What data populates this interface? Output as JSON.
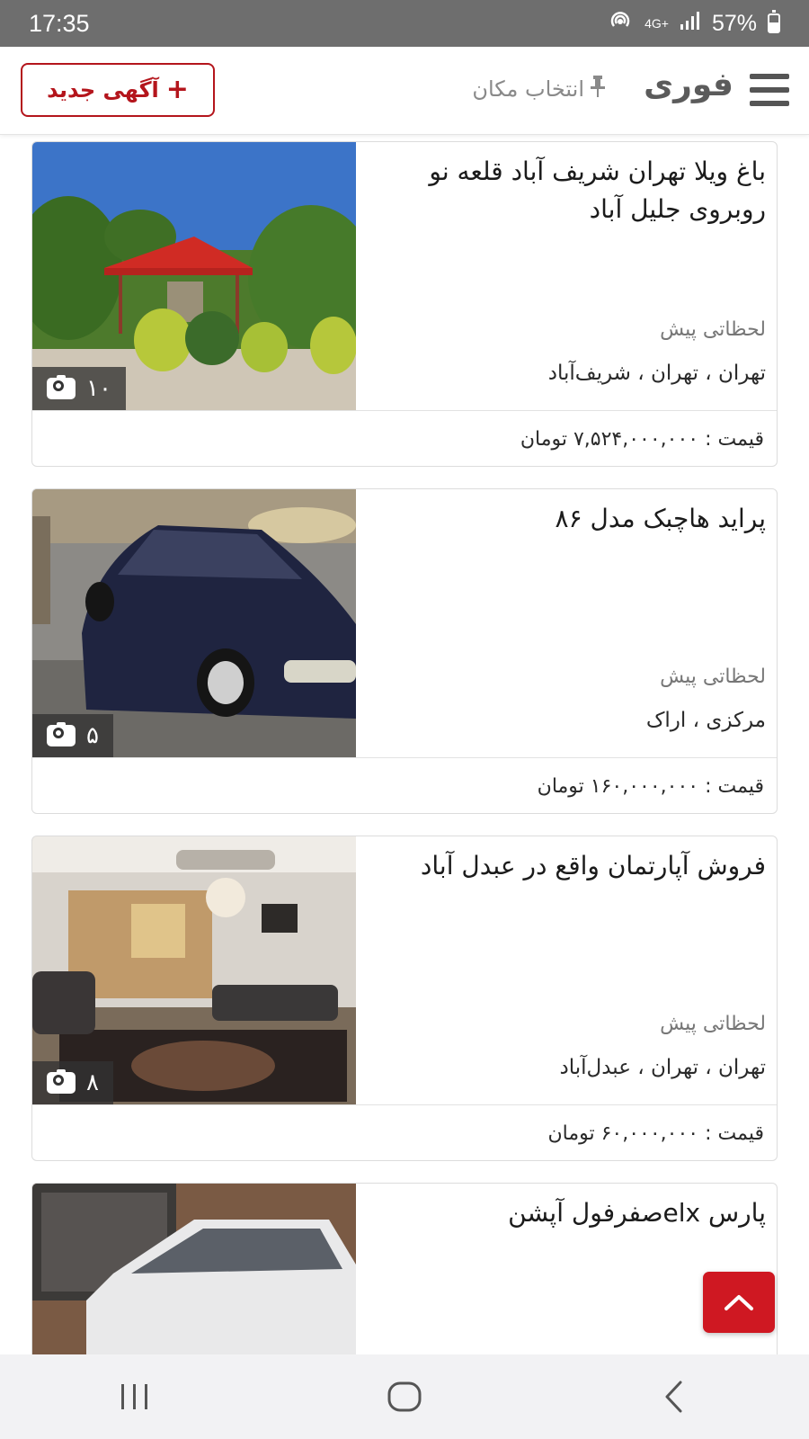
{
  "status_bar": {
    "time": "17:35",
    "network": "4G+",
    "battery": "57%",
    "hotspot_icon": "hotspot-icon",
    "signal_icon": "signal-icon"
  },
  "header": {
    "brand": "فوری",
    "location_picker": "انتخاب مکان",
    "new_ad_button": "آگهی جدید",
    "menu_icon": "hamburger-menu-icon",
    "pin_icon": "pin-icon"
  },
  "ads": [
    {
      "title": "باغ ویلا تهران شریف آباد قلعه نو روبروی جلیل آباد",
      "time": "لحظاتی پیش",
      "location": "تهران ، تهران ، شریف‌آباد",
      "price": "قیمت : ۷,۵۲۴,۰۰۰,۰۰۰ تومان",
      "photo_count": "۱۰",
      "photo_subject": "garden villa with red gazebo"
    },
    {
      "title": "پراید هاچبک مدل ۸۶",
      "time": "لحظاتی پیش",
      "location": "مرکزی ، اراک",
      "price": "قیمت : ۱۶۰,۰۰۰,۰۰۰ تومان",
      "photo_count": "۵",
      "photo_subject": "dark blue hatchback car"
    },
    {
      "title": "فروش آپارتمان واقع در عبدل آباد",
      "time": "لحظاتی پیش",
      "location": "تهران ، تهران ، عبدل‌آباد",
      "price": "قیمت : ۶۰,۰۰۰,۰۰۰ تومان",
      "photo_count": "۸",
      "photo_subject": "apartment living room"
    },
    {
      "title": "پارس elxصفرفول آپشن",
      "photo_subject": "white sedan car"
    }
  ],
  "colors": {
    "brand_red": "#cf1822",
    "status_bar_bg": "#6e6e6e"
  }
}
